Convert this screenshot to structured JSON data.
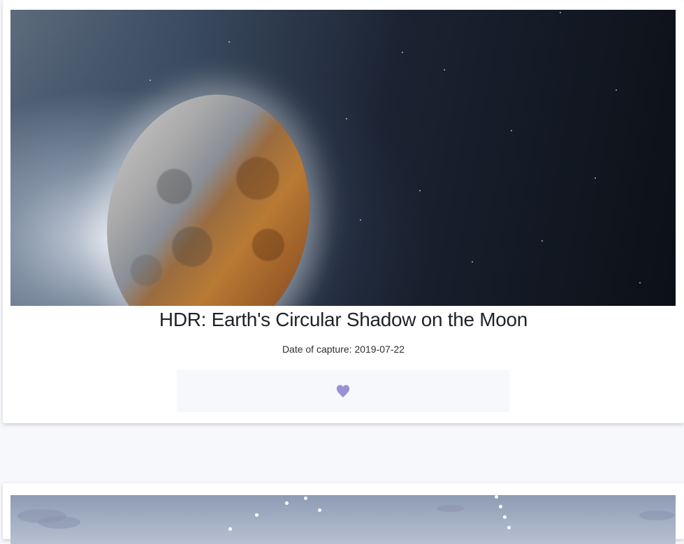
{
  "posts": [
    {
      "title": "HDR: Earth's Circular Shadow on the Moon",
      "date_label": "Date of capture: 2019-07-22",
      "like_icon": "heart-icon",
      "like_color": "#9b8fd6"
    }
  ]
}
